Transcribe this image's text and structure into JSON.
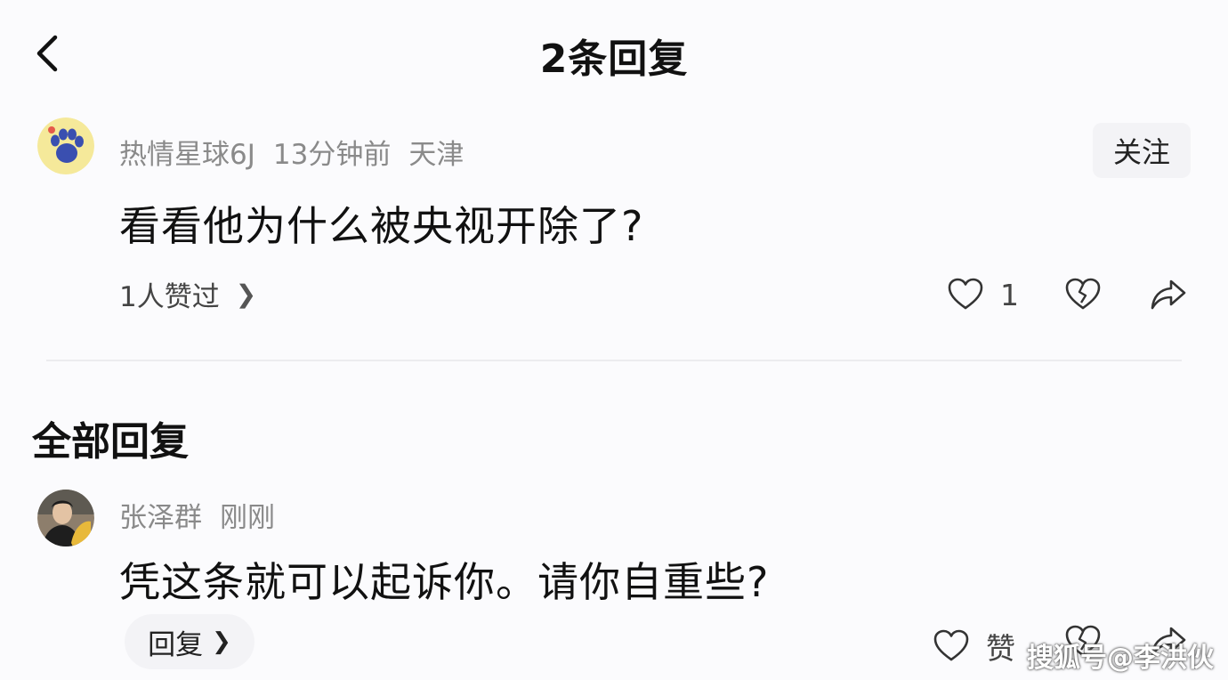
{
  "header": {
    "title": "2条回复",
    "back_icon": "chevron-left-icon"
  },
  "main_comment": {
    "username": "热情星球6J",
    "time": "13分钟前",
    "location": "天津",
    "follow_label": "关注",
    "text": "看看他为什么被央视开除了?",
    "likes_summary": "1人赞过",
    "like_count": "1"
  },
  "replies_section": {
    "title": "全部回复",
    "items": [
      {
        "username": "张泽群",
        "time": "刚刚",
        "text": "凭这条就可以起诉你。请你自重些?",
        "reply_label": "回复",
        "like_label": "赞"
      }
    ]
  },
  "watermark": "搜狐号@李洪伙",
  "colors": {
    "background": "#fbfbfd",
    "meta_gray": "#8a8a8a",
    "button_bg": "#f3f3f6"
  }
}
